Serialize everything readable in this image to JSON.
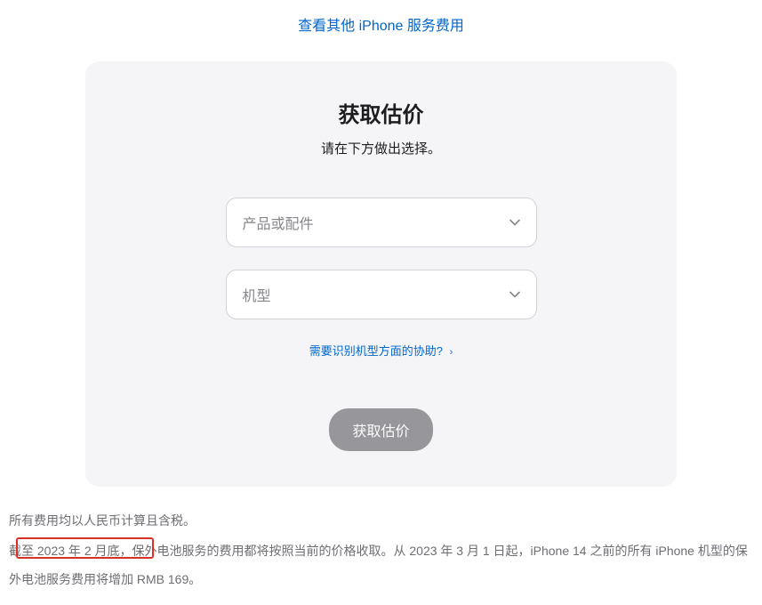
{
  "topLink": {
    "label": "查看其他 iPhone 服务费用"
  },
  "card": {
    "title": "获取估价",
    "subtitle": "请在下方做出选择。",
    "selects": {
      "product": {
        "placeholder": "产品或配件"
      },
      "model": {
        "placeholder": "机型"
      }
    },
    "helpLink": {
      "label": "需要识别机型方面的协助?"
    },
    "submitButton": {
      "label": "获取估价"
    }
  },
  "footer": {
    "line1": "所有费用均以人民币计算且含税。",
    "line2": "截至 2023 年 2 月底，保外电池服务的费用都将按照当前的价格收取。从 2023 年 3 月 1 日起，iPhone 14 之前的所有 iPhone 机型的保外电池服务费用将增加 RMB 169。"
  }
}
